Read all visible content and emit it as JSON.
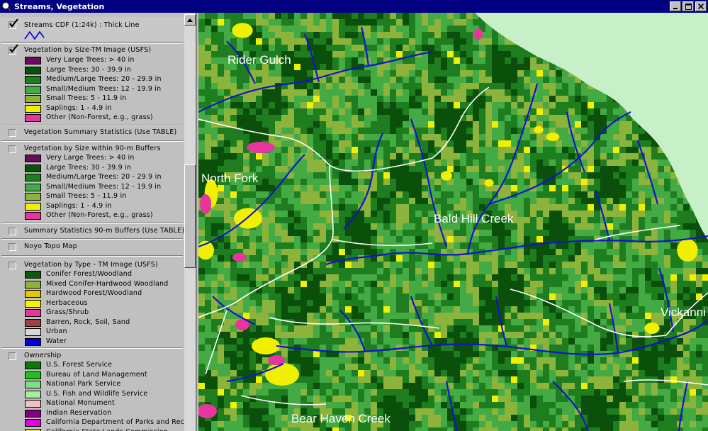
{
  "window": {
    "title": "Streams, Vegetation"
  },
  "toc": {
    "streams": {
      "name": "Streams CDF (1:24k) : Thick Line",
      "checked": true
    },
    "veg_size": {
      "name": "Vegetation by Size-TM Image (USFS)",
      "checked": true,
      "classes": [
        {
          "label": "Very Large Trees: > 40  in",
          "color": "#6b0a5a"
        },
        {
          "label": "Large Trees: 30 - 39.9 in",
          "color": "#0a4f0a"
        },
        {
          "label": "Medium/Large Trees: 20 - 29.9 in",
          "color": "#1e7d1e"
        },
        {
          "label": "Small/Medium Trees: 12 - 19.9 in",
          "color": "#44aa44"
        },
        {
          "label": "Small Trees: 5 - 11.9 in",
          "color": "#8cb43c"
        },
        {
          "label": "Saplings: 1 - 4.9 in",
          "color": "#f0f000"
        },
        {
          "label": "Other (Non-Forest, e.g., grass)",
          "color": "#e8359e"
        }
      ]
    },
    "veg_summary": {
      "name": "Vegetation Summary Statistics (Use TABLE)",
      "checked": false
    },
    "veg_size_buffers": {
      "name": "Vegetation by Size within 90-m Buffers",
      "checked": false,
      "classes": [
        {
          "label": "Very Large Trees: > 40  in",
          "color": "#6b0a5a"
        },
        {
          "label": "Large Trees: 30 - 39.9 in",
          "color": "#0a4f0a"
        },
        {
          "label": "Medium/Large Trees: 20 - 29.9 in",
          "color": "#1e7d1e"
        },
        {
          "label": "Small/Medium Trees: 12 - 19.9 in",
          "color": "#44aa44"
        },
        {
          "label": "Small Trees: 5 - 11.9 in",
          "color": "#8cb43c"
        },
        {
          "label": "Saplings: 1 - 4.9 in",
          "color": "#f0f000"
        },
        {
          "label": "Other (Non-Forest, e.g., grass)",
          "color": "#e8359e"
        }
      ]
    },
    "summary_buffers": {
      "name": "Summary Statistics 90-m Buffers (Use TABLE)",
      "checked": false
    },
    "noyo_topo": {
      "name": "Noyo Topo Map",
      "checked": false
    },
    "veg_type": {
      "name": "Vegetation by Type - TM Image (USFS)",
      "checked": false,
      "classes": [
        {
          "label": "Conifer Forest/Woodland",
          "color": "#0a5a0a"
        },
        {
          "label": "Mixed Conifer-Hardwood Woodland",
          "color": "#8cb43c"
        },
        {
          "label": "Hardwood Forest/Woodland",
          "color": "#e0c800"
        },
        {
          "label": "Herbaceous",
          "color": "#f5f500"
        },
        {
          "label": "Grass/Shrub",
          "color": "#e8359e"
        },
        {
          "label": "Barren, Rock, Soil, Sand",
          "color": "#a04040"
        },
        {
          "label": "Urban",
          "color": "#d8d8d8"
        },
        {
          "label": "Water",
          "color": "#0000e0"
        }
      ]
    },
    "ownership": {
      "name": "Ownership",
      "checked": false,
      "classes": [
        {
          "label": "U.S. Forest Service",
          "color": "#0a780a"
        },
        {
          "label": "Bureau of Land Management",
          "color": "#20c020"
        },
        {
          "label": "National Park Service",
          "color": "#80e080"
        },
        {
          "label": "U.S. Fish and Wildlife Service",
          "color": "#a0f0a0"
        },
        {
          "label": "National Monument",
          "color": "#f0c0c0"
        },
        {
          "label": "Indian Reservation",
          "color": "#800080"
        },
        {
          "label": "California Department of Parks and Recreation",
          "color": "#e000e0"
        },
        {
          "label": "California State Lands Commission",
          "color": "#f0e040"
        }
      ]
    }
  },
  "map": {
    "labels": [
      {
        "text": "Rider Gulch"
      },
      {
        "text": "North Fork"
      },
      {
        "text": "Bald Hill Creek"
      },
      {
        "text": "Vickanni"
      },
      {
        "text": "Bear Haven Creek"
      }
    ],
    "colors": {
      "stream": "#1414c8",
      "boundary": "#ffffff",
      "ocean": "#c8f0c8"
    }
  }
}
